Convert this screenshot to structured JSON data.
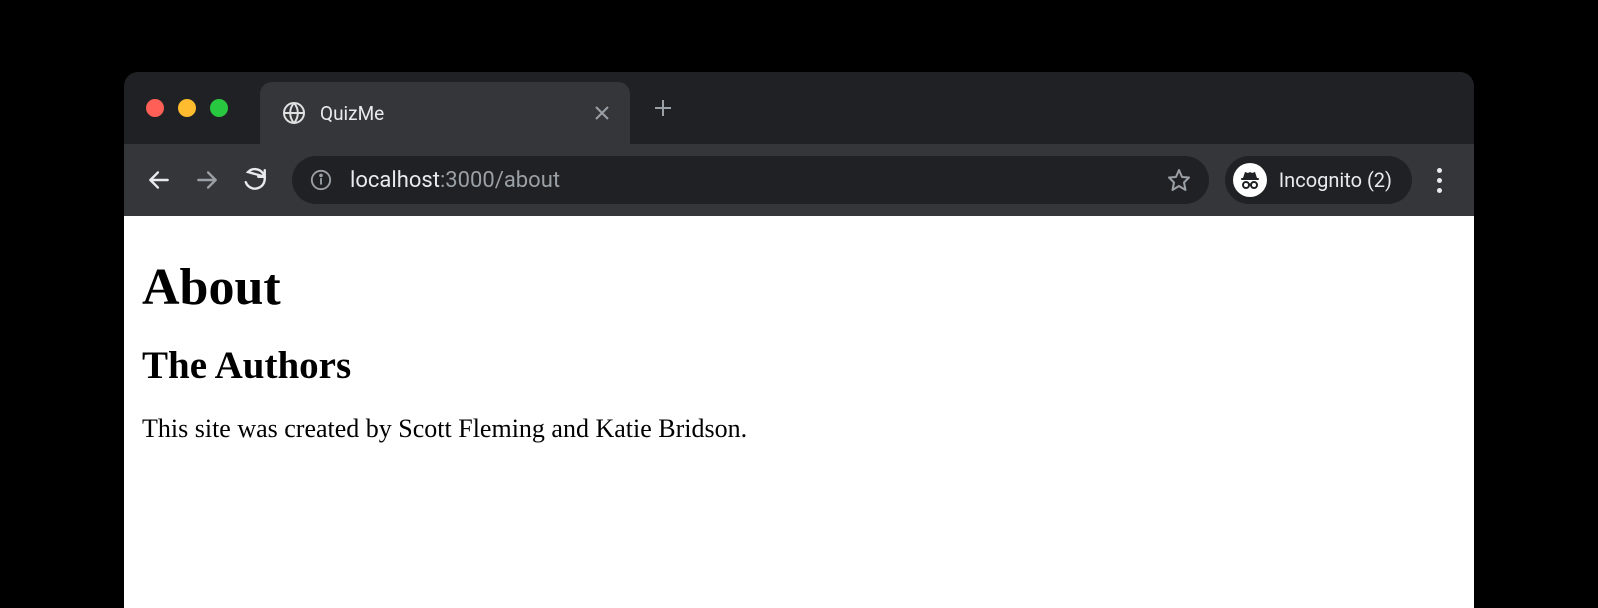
{
  "tab": {
    "title": "QuizMe"
  },
  "address": {
    "host": "localhost",
    "port": ":3000",
    "path": "/about"
  },
  "incognito": {
    "label": "Incognito (2)"
  },
  "page": {
    "h1": "About",
    "h2": "The Authors",
    "body": "This site was created by Scott Fleming and Katie Bridson."
  }
}
